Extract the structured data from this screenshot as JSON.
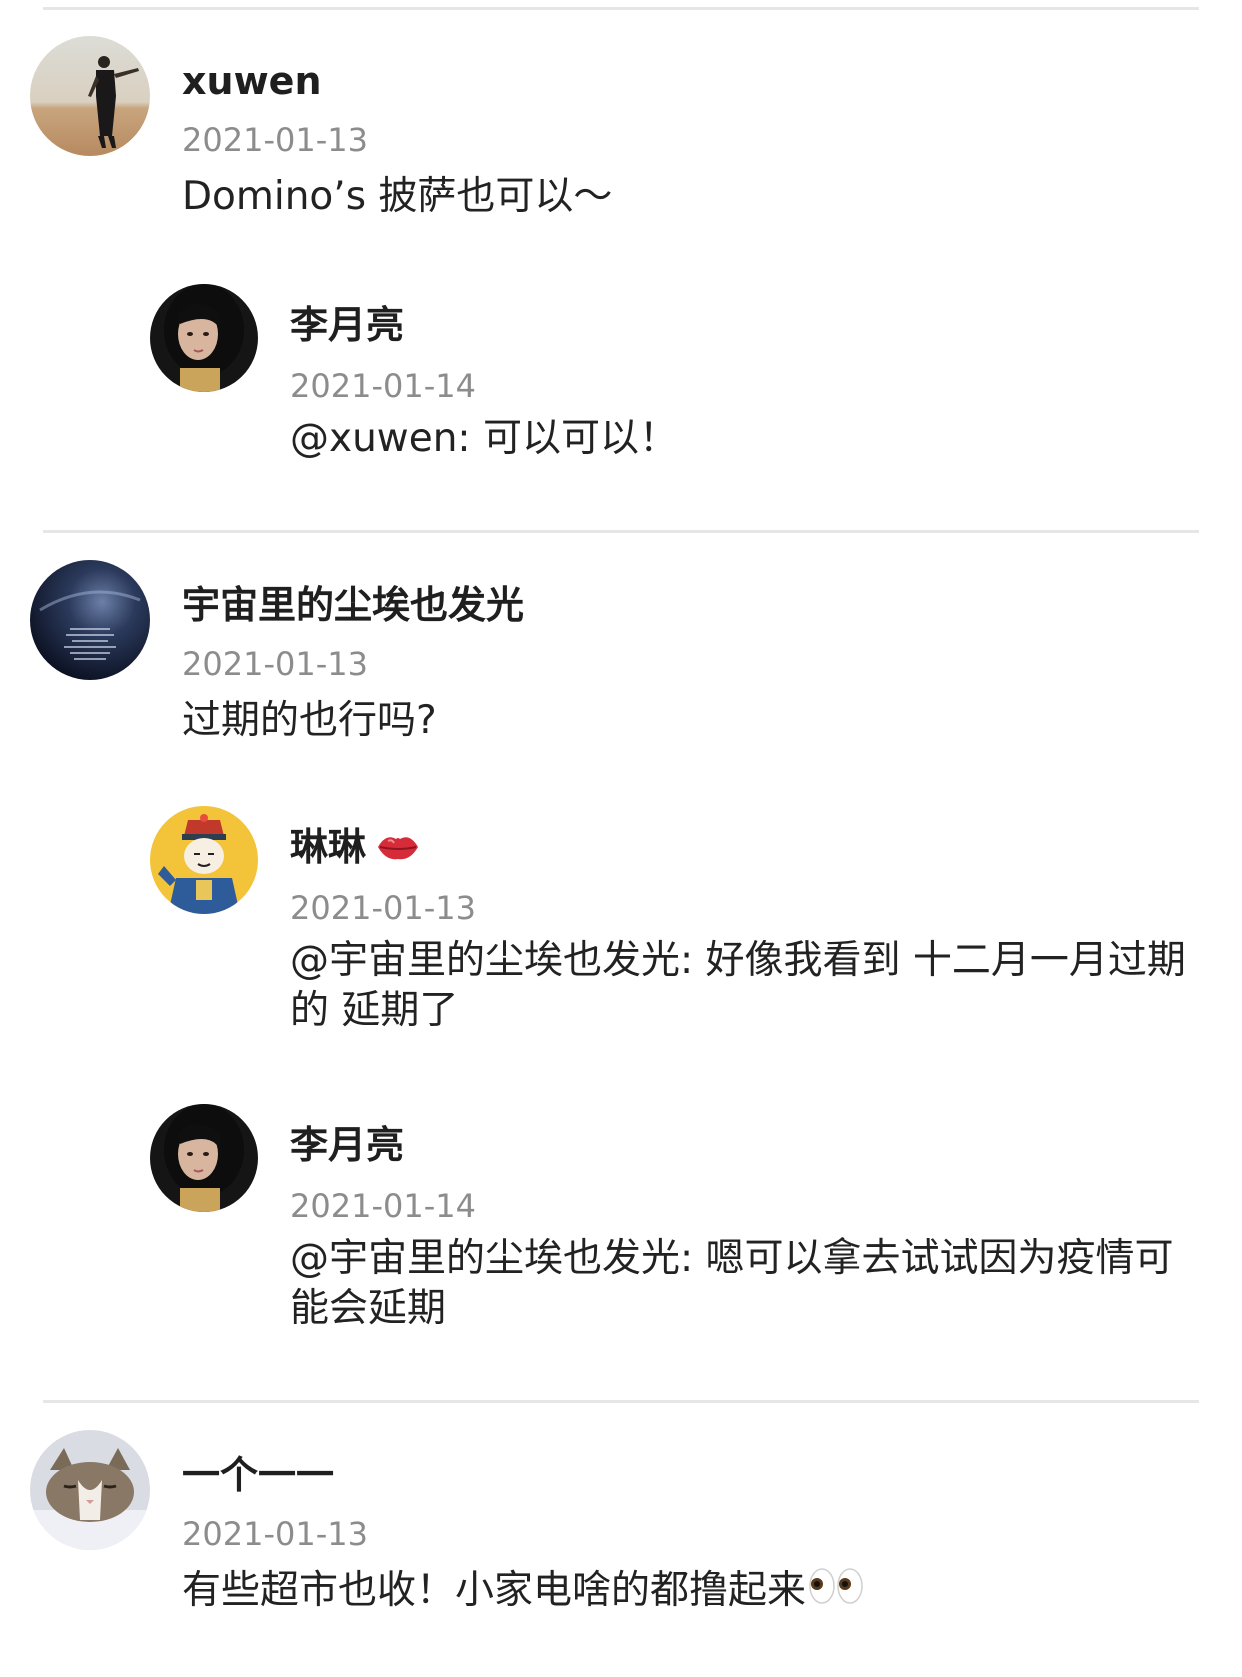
{
  "comments": [
    {
      "user": "xuwen",
      "date": "2021-01-13",
      "text": "Domino’s 披萨也可以～",
      "avatar": "avatar-beach-person",
      "replies": [
        {
          "user": "李月亮",
          "date": "2021-01-14",
          "text": "@xuwen: 可以可以！",
          "avatar": "avatar-girl-portrait"
        }
      ]
    },
    {
      "user": "宇宙里的尘埃也发光",
      "date": "2021-01-13",
      "text": "过期的也行吗?",
      "avatar": "avatar-night-sky",
      "replies": [
        {
          "user": "琳琳",
          "name_emoji": "lips-icon",
          "date": "2021-01-13",
          "text": "@宇宙里的尘埃也发光: 好像我看到 十二月一月过期的 延期了",
          "avatar": "avatar-cartoon-qing-official"
        },
        {
          "user": "李月亮",
          "date": "2021-01-14",
          "text": "@宇宙里的尘埃也发光: 嗯可以拿去试试因为疫情可能会延期",
          "avatar": "avatar-girl-portrait"
        }
      ]
    },
    {
      "user": "一个一一",
      "date": "2021-01-13",
      "text": "有些超市也收！小家电啥的都撸起来",
      "text_emoji": "eyes-icon",
      "avatar": "avatar-cat"
    }
  ],
  "colors": {
    "name": "#1f1f1f",
    "date": "#8c8c8c",
    "text": "#222222",
    "divider": "#e6e6e6"
  }
}
